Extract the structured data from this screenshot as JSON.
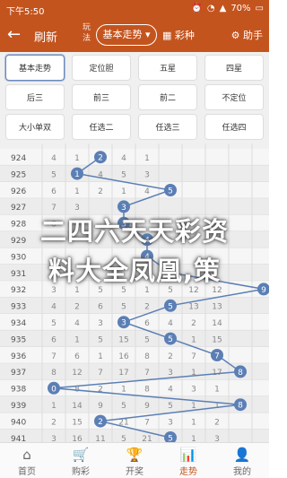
{
  "status": {
    "time": "下午5:50",
    "battery": "70%",
    "icons": [
      "sim-icon",
      "alarm-icon",
      "wifi-icon",
      "signal-icon",
      "battery-icon"
    ]
  },
  "toolbar": {
    "back_icon": "back-arrow-icon",
    "refresh": "刷新",
    "play_label": "玩法",
    "mode": "基本走势",
    "color_set": "彩种",
    "helper": "助手"
  },
  "tabs": [
    [
      "基本走势",
      "定位胆",
      "五星",
      "四星"
    ],
    [
      "后三",
      "前三",
      "前二",
      "不定位"
    ],
    [
      "大小单双",
      "任选二",
      "任选三",
      "任选四"
    ]
  ],
  "chart_data": {
    "type": "table",
    "rows": [
      {
        "issue": "924",
        "cells": [
          "4",
          "1",
          "2",
          "4",
          "1",
          "",
          "",
          "",
          ""
        ],
        "hit": 2
      },
      {
        "issue": "925",
        "cells": [
          "5",
          "1",
          "4",
          "5",
          "3",
          "",
          "",
          "",
          ""
        ],
        "hit": 1
      },
      {
        "issue": "926",
        "cells": [
          "6",
          "1",
          "2",
          "1",
          "4",
          "5",
          "",
          "",
          ""
        ],
        "hit": 5
      },
      {
        "issue": "927",
        "cells": [
          "7",
          "3",
          "",
          "",
          "",
          "",
          "",
          "",
          ""
        ],
        "hit": 3
      },
      {
        "issue": "928",
        "cells": [
          "8",
          "4",
          "",
          "",
          "",
          "",
          "",
          "",
          ""
        ],
        "hit": 3
      },
      {
        "issue": "929",
        "cells": [
          "",
          "",
          "",
          "",
          "",
          "",
          "",
          "",
          ""
        ],
        "hit": 4
      },
      {
        "issue": "930",
        "cells": [
          "",
          "",
          "",
          "",
          "",
          "",
          "",
          "",
          ""
        ],
        "hit": 4
      },
      {
        "issue": "931",
        "cells": [
          "",
          "",
          "",
          "",
          "",
          "",
          "",
          "",
          ""
        ],
        "hit": 5
      },
      {
        "issue": "932",
        "cells": [
          "3",
          "1",
          "5",
          "5",
          "1",
          "5",
          "12",
          "12"
        ],
        "hit": 9
      },
      {
        "issue": "933",
        "cells": [
          "4",
          "2",
          "6",
          "5",
          "2",
          "1",
          "13",
          "13"
        ],
        "hit": 5
      },
      {
        "issue": "934",
        "cells": [
          "5",
          "4",
          "3",
          "14",
          "6",
          "4",
          "2",
          "14"
        ],
        "hit": 3
      },
      {
        "issue": "935",
        "cells": [
          "6",
          "1",
          "5",
          "15",
          "5",
          "1",
          "1",
          "15"
        ],
        "hit": 5
      },
      {
        "issue": "936",
        "cells": [
          "7",
          "6",
          "1",
          "16",
          "8",
          "2",
          "7",
          "16"
        ],
        "hit": 7
      },
      {
        "issue": "937",
        "cells": [
          "8",
          "12",
          "7",
          "17",
          "7",
          "3",
          "1",
          "17"
        ],
        "hit": 8
      },
      {
        "issue": "938",
        "cells": [
          "0",
          "8",
          "2",
          "1",
          "8",
          "4",
          "3",
          "1"
        ],
        "hit": 0
      },
      {
        "issue": "939",
        "cells": [
          "1",
          "14",
          "9",
          "5",
          "9",
          "5",
          "1",
          "1"
        ],
        "hit": 8
      },
      {
        "issue": "940",
        "cells": [
          "2",
          "15",
          "2",
          "21",
          "7",
          "3",
          "1",
          "2"
        ],
        "hit": 2
      },
      {
        "issue": "941",
        "cells": [
          "3",
          "16",
          "11",
          "5",
          "21",
          "9",
          "1",
          "3"
        ],
        "hit": 5
      }
    ],
    "hits": [
      2,
      1,
      5,
      3,
      3,
      4,
      4,
      5,
      9,
      5,
      3,
      5,
      7,
      8,
      0,
      8,
      2,
      5
    ],
    "issues": [
      "924",
      "925",
      "926",
      "927",
      "928",
      "929",
      "930",
      "931",
      "932",
      "933",
      "934",
      "935",
      "936",
      "937",
      "938",
      "939",
      "940",
      "941"
    ]
  },
  "overlay": {
    "line1": "二四六天天彩资",
    "line2": "料大全凤凰,策"
  },
  "nav": [
    {
      "label": "首页",
      "icon": "home-icon"
    },
    {
      "label": "购彩",
      "icon": "cart-icon"
    },
    {
      "label": "开奖",
      "icon": "trophy-icon"
    },
    {
      "label": "走势",
      "icon": "trend-icon"
    },
    {
      "label": "我的",
      "icon": "user-icon"
    }
  ],
  "colors": {
    "brand": "#c4541e",
    "ball": "#5b7fb5"
  }
}
